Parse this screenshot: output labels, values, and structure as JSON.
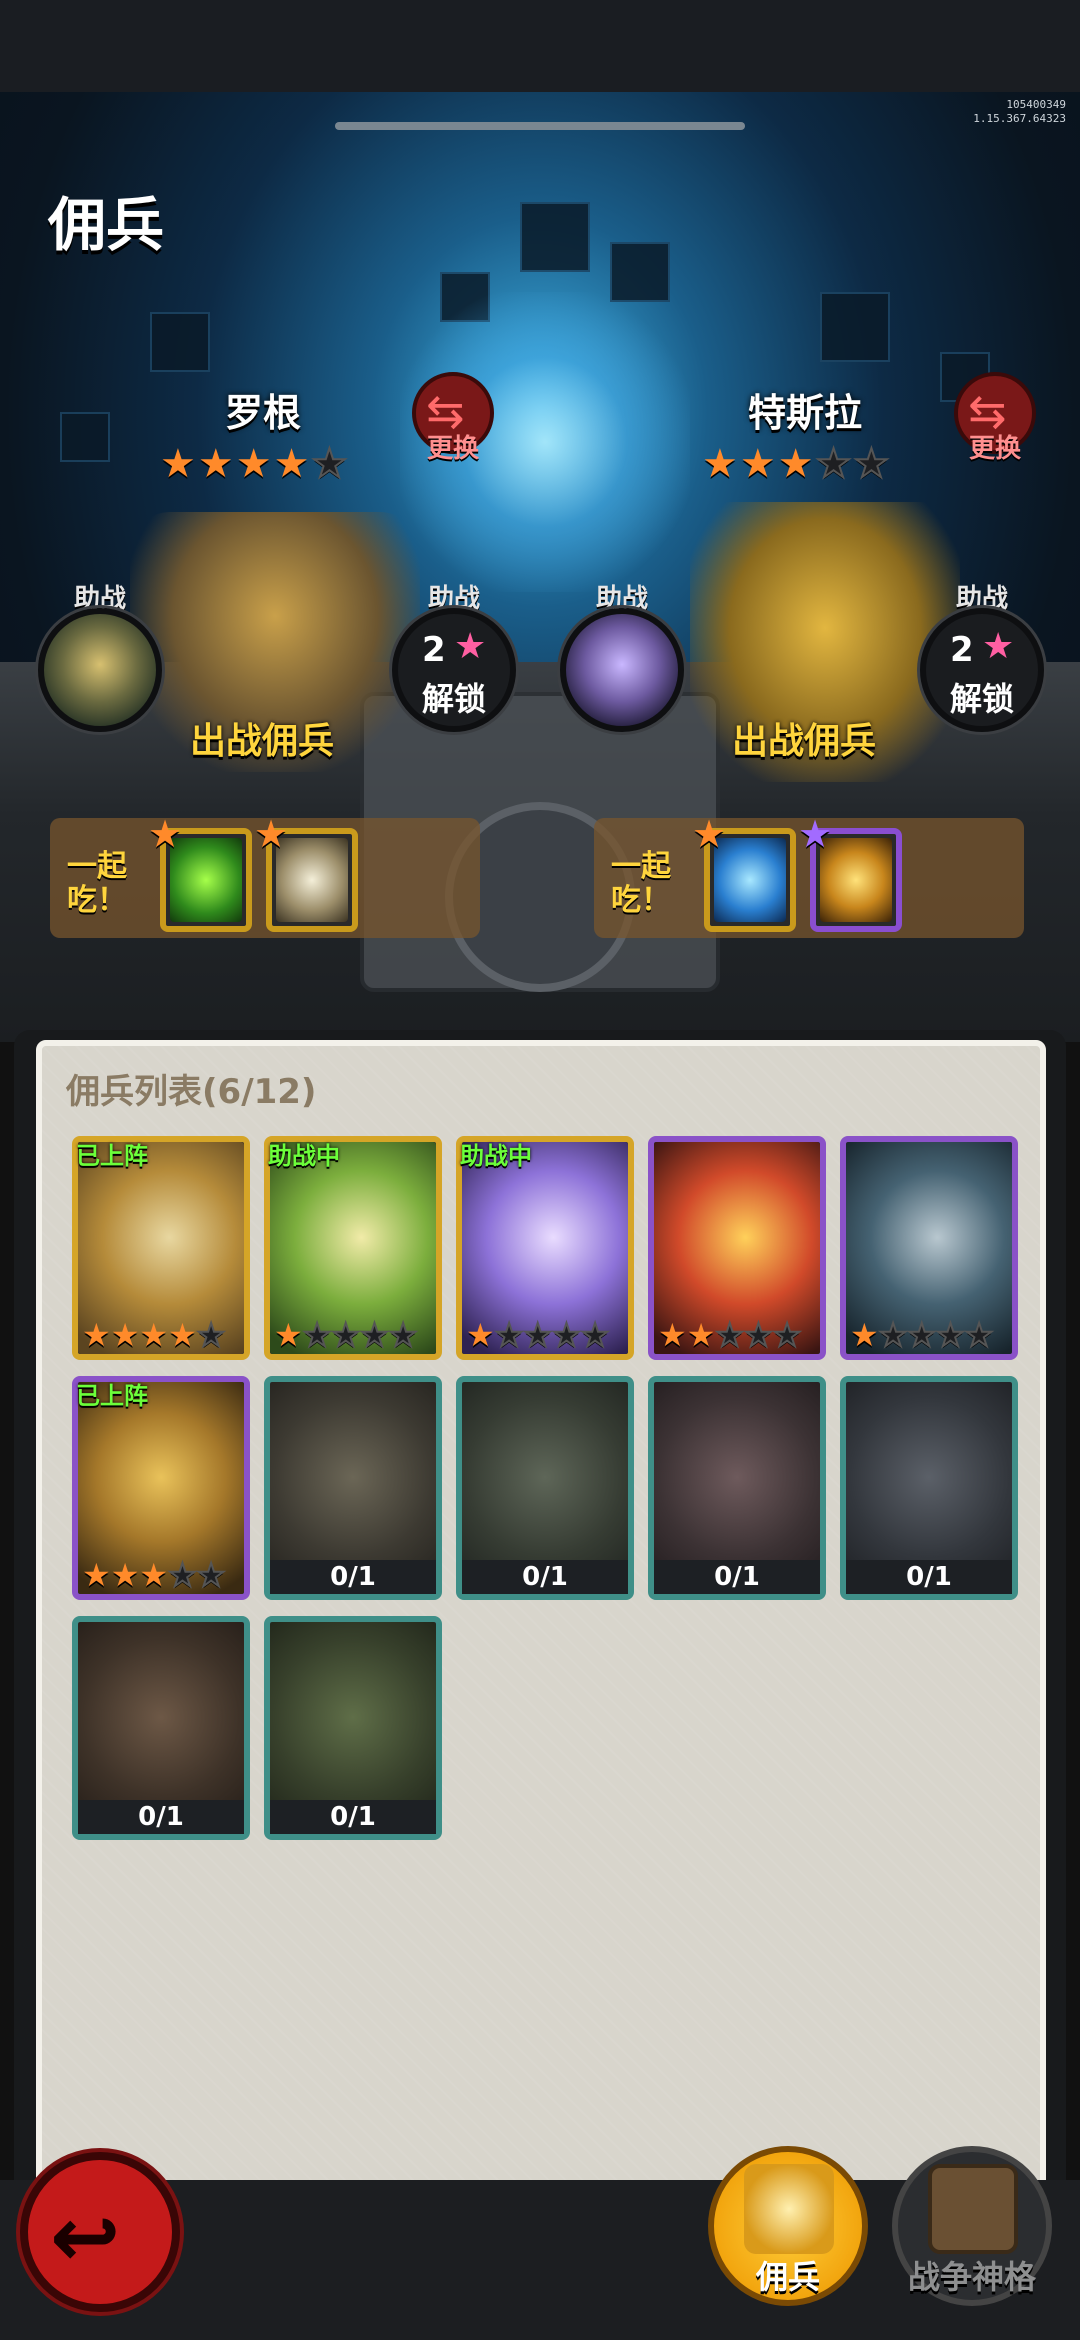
{
  "version": {
    "line1": "105400349",
    "line2": "1.15.367.64323"
  },
  "page_title": "佣兵",
  "slots": [
    {
      "name": "罗根",
      "stars_on": 4,
      "stars_total": 5,
      "swap_label": "更换",
      "deploy_label": "出战佣兵",
      "assist_left": {
        "label": "助战"
      },
      "assist_right": {
        "label": "助战",
        "unlock_num": "2",
        "unlock_text": "解锁"
      },
      "eat_label": "一起吃！"
    },
    {
      "name": "特斯拉",
      "stars_on": 3,
      "stars_total": 5,
      "swap_label": "更换",
      "deploy_label": "出战佣兵",
      "assist_left": {
        "label": "助战"
      },
      "assist_right": {
        "label": "助战",
        "unlock_num": "2",
        "unlock_text": "解锁"
      },
      "eat_label": "一起吃！"
    }
  ],
  "list": {
    "title": "佣兵列表(6/12)",
    "owned": [
      {
        "status": "已上阵",
        "stars": 4,
        "frame": "gold"
      },
      {
        "status": "助战中",
        "stars": 1,
        "frame": "gold"
      },
      {
        "status": "助战中",
        "stars": 1,
        "frame": "gold"
      },
      {
        "status": "",
        "stars": 2,
        "frame": "purple"
      },
      {
        "status": "",
        "stars": 1,
        "frame": "purple"
      },
      {
        "status": "已上阵",
        "stars": 3,
        "frame": "purple"
      }
    ],
    "locked": [
      "0/1",
      "0/1",
      "0/1",
      "0/1",
      "0/1",
      "0/1"
    ]
  },
  "nav": {
    "mercenary": "佣兵",
    "war_god": "战争神格"
  },
  "colors": {
    "gold_frame": "#d5a527",
    "purple_frame": "#8a52c8",
    "locked_frame": "#3f8f88",
    "star": "#ff8a2a",
    "status_green": "#6cff3a"
  }
}
